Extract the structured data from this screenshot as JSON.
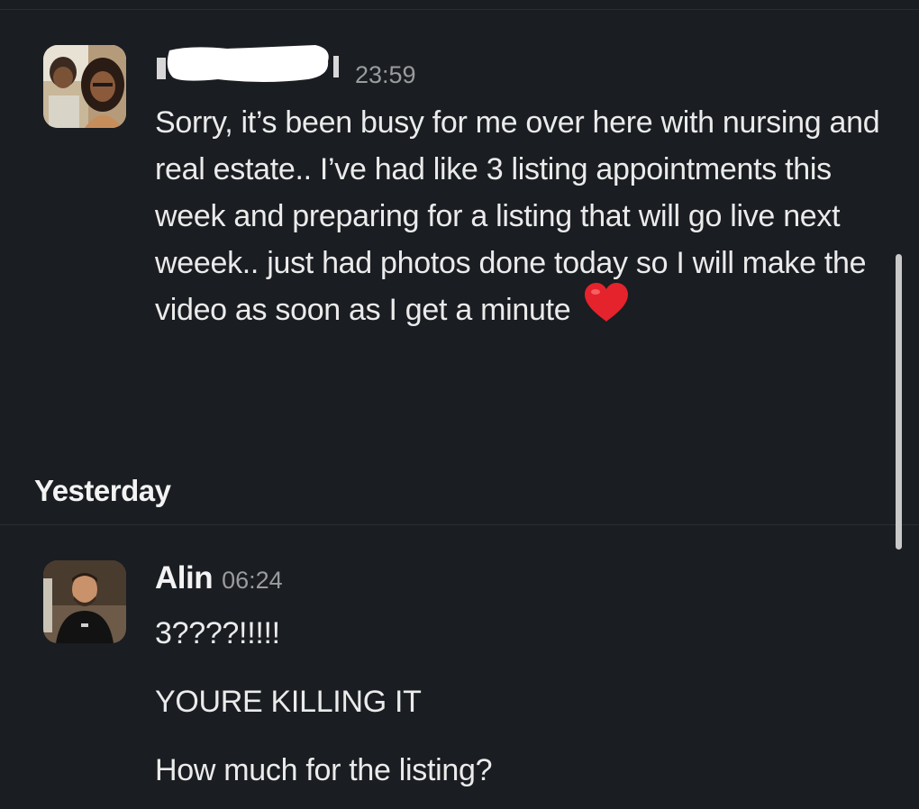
{
  "messages": [
    {
      "sender": "",
      "time": "23:59",
      "text": "Sorry, it’s been busy for me over here with nursing and real estate.. I’ve had like 3 listing appointments this week and preparing for a listing that will go live next weeek.. just had photos done today so I will make the video as soon as I get a minute",
      "emoji": "red-heart-emoji"
    }
  ],
  "day_separator": "Yesterday",
  "reply": {
    "sender": "Alin",
    "time": "06:24",
    "lines": [
      "3????!!!!!",
      "YOURE KILLING IT",
      "How much for the listing?"
    ]
  },
  "colors": {
    "background": "#1a1d21",
    "text": "#ebebeb",
    "timestamp": "#9a9b9d",
    "redaction": "#ffffff",
    "heart": "#e5232c"
  }
}
